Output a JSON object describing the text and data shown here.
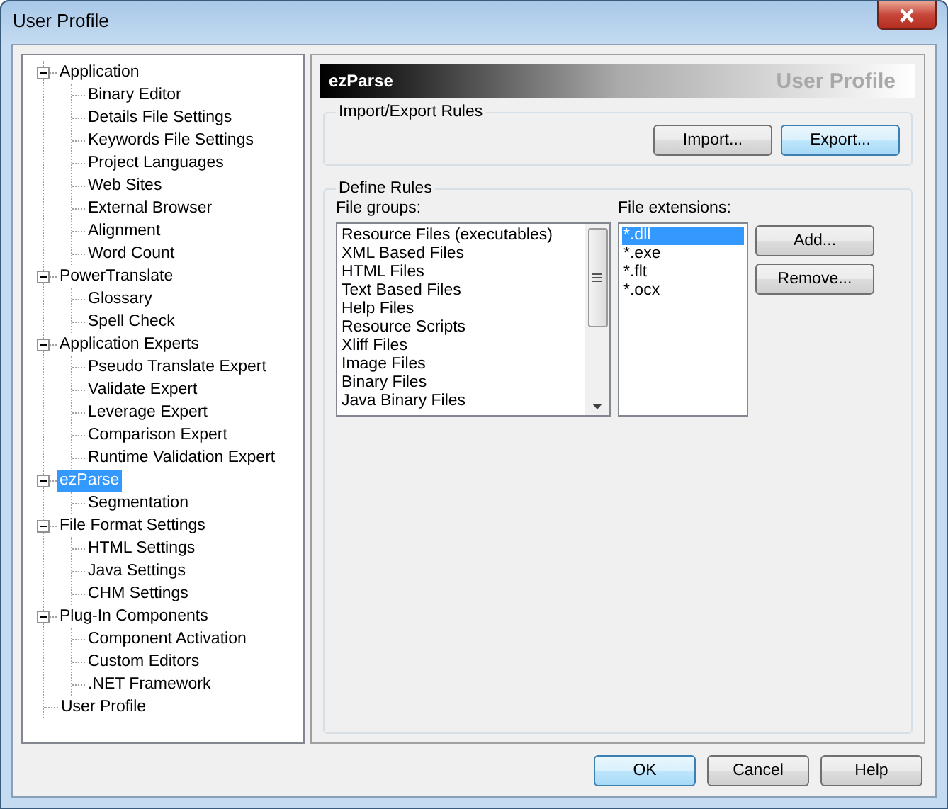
{
  "window": {
    "title": "User Profile"
  },
  "tree": [
    {
      "label": "Application",
      "expanded": true,
      "selected": false,
      "children": [
        {
          "label": "Binary Editor",
          "selected": false
        },
        {
          "label": "Details File Settings",
          "selected": false
        },
        {
          "label": "Keywords File Settings",
          "selected": false
        },
        {
          "label": "Project Languages",
          "selected": false
        },
        {
          "label": "Web Sites",
          "selected": false
        },
        {
          "label": "External Browser",
          "selected": false
        },
        {
          "label": "Alignment",
          "selected": false
        },
        {
          "label": "Word Count",
          "selected": false
        }
      ]
    },
    {
      "label": "PowerTranslate",
      "expanded": true,
      "selected": false,
      "children": [
        {
          "label": "Glossary",
          "selected": false
        },
        {
          "label": "Spell Check",
          "selected": false
        }
      ]
    },
    {
      "label": "Application Experts",
      "expanded": true,
      "selected": false,
      "children": [
        {
          "label": "Pseudo Translate Expert",
          "selected": false
        },
        {
          "label": "Validate Expert",
          "selected": false
        },
        {
          "label": "Leverage Expert",
          "selected": false
        },
        {
          "label": "Comparison Expert",
          "selected": false
        },
        {
          "label": "Runtime Validation Expert",
          "selected": false
        }
      ]
    },
    {
      "label": "ezParse",
      "expanded": true,
      "selected": true,
      "children": [
        {
          "label": "Segmentation",
          "selected": false
        }
      ]
    },
    {
      "label": "File Format Settings",
      "expanded": true,
      "selected": false,
      "children": [
        {
          "label": "HTML Settings",
          "selected": false
        },
        {
          "label": "Java Settings",
          "selected": false
        },
        {
          "label": "CHM Settings",
          "selected": false
        }
      ]
    },
    {
      "label": "Plug-In Components",
      "expanded": true,
      "selected": false,
      "children": [
        {
          "label": "Component Activation",
          "selected": false
        },
        {
          "label": "Custom Editors",
          "selected": false
        },
        {
          "label": ".NET Framework",
          "selected": false
        }
      ]
    },
    {
      "label": "User Profile",
      "selected": false
    }
  ],
  "header": {
    "title": "ezParse",
    "subtitle": "User Profile"
  },
  "import_export": {
    "legend": "Import/Export Rules",
    "buttons": [
      {
        "label": "Import...",
        "focused": false
      },
      {
        "label": "Export...",
        "focused": true
      }
    ]
  },
  "define_rules": {
    "legend": "Define Rules",
    "file_groups_label": "File groups:",
    "file_groups": [
      {
        "label": "Resource Files (executables)",
        "selected": false
      },
      {
        "label": "XML Based Files",
        "selected": false
      },
      {
        "label": "HTML Files",
        "selected": false
      },
      {
        "label": "Text Based Files",
        "selected": false
      },
      {
        "label": "Help Files",
        "selected": false
      },
      {
        "label": "Resource Scripts",
        "selected": false
      },
      {
        "label": "Xliff Files",
        "selected": false
      },
      {
        "label": "Image Files",
        "selected": false
      },
      {
        "label": "Binary Files",
        "selected": false
      },
      {
        "label": "Java Binary Files",
        "selected": false
      }
    ],
    "file_extensions_label": "File extensions:",
    "file_extensions": [
      {
        "label": "*.dll",
        "selected": true
      },
      {
        "label": "*.exe",
        "selected": false
      },
      {
        "label": "*.flt",
        "selected": false
      },
      {
        "label": "*.ocx",
        "selected": false
      }
    ],
    "buttons": [
      {
        "label": "Add..."
      },
      {
        "label": "Remove..."
      }
    ]
  },
  "footer_buttons": [
    {
      "label": "OK",
      "focused": true
    },
    {
      "label": "Cancel",
      "focused": false
    },
    {
      "label": "Help",
      "focused": false
    }
  ]
}
